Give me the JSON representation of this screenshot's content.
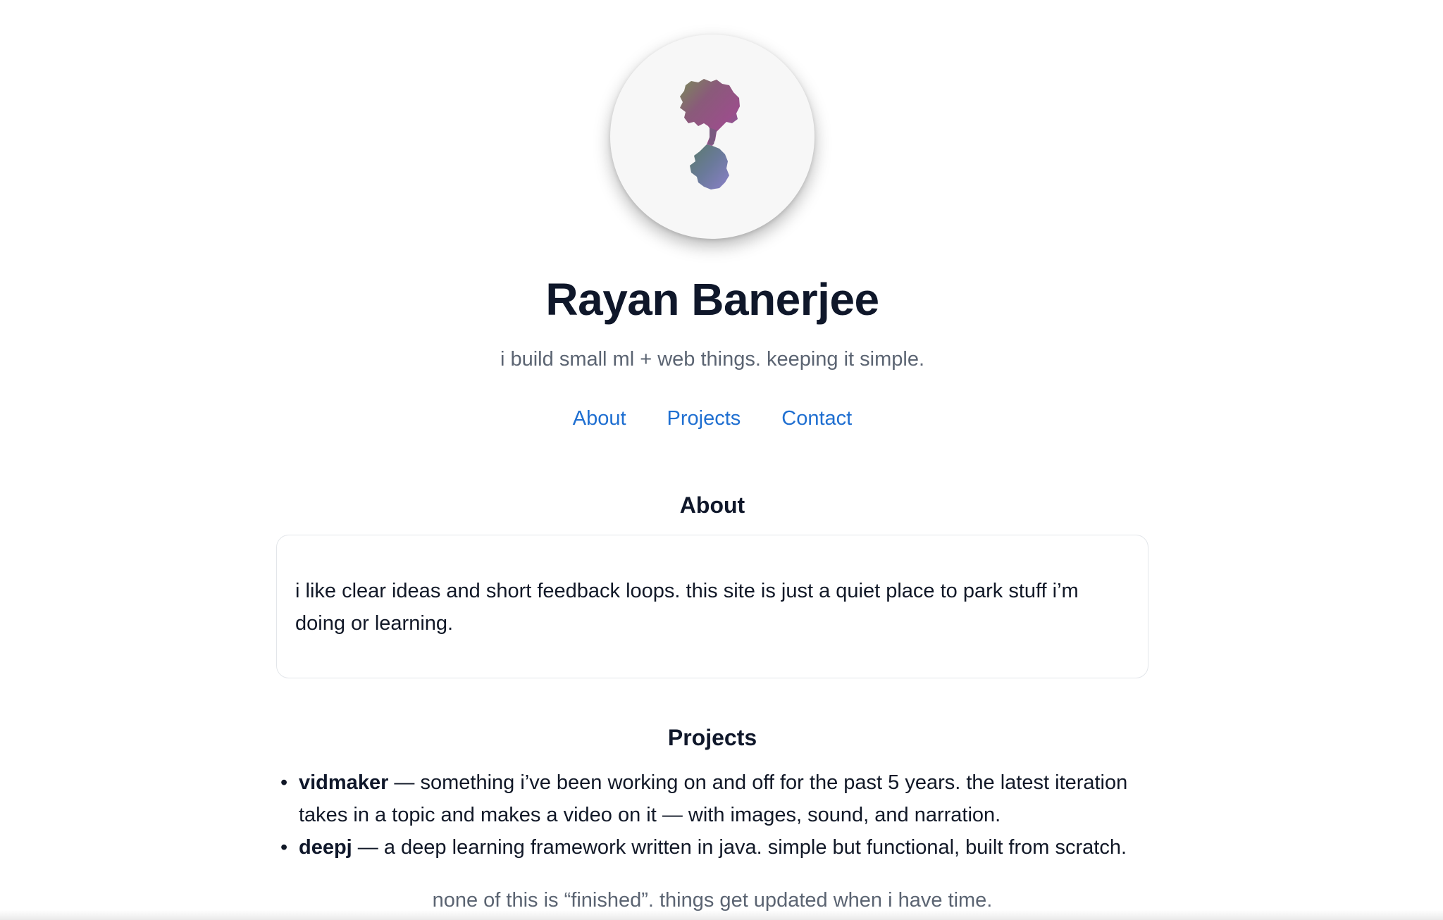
{
  "profile": {
    "name": "Rayan Banerjee",
    "tagline": "i build small ml + web things. keeping it simple."
  },
  "nav": {
    "items": [
      "About",
      "Projects",
      "Contact"
    ]
  },
  "about": {
    "title": "About",
    "text": "i like clear ideas and short feedback loops. this site is just a quiet place to park stuff i’m doing or learning."
  },
  "projects": {
    "title": "Projects",
    "items": [
      {
        "name": "vidmaker",
        "description": " — something i’ve been working on and off for the past 5 years. the latest iteration takes in a topic and makes a video on it — with images, sound, and narration."
      },
      {
        "name": "deepj",
        "description": " — a deep learning framework written in java. simple but functional, built from scratch."
      }
    ]
  },
  "footer": {
    "note": "none of this is “finished”. things get updated when i have time."
  }
}
